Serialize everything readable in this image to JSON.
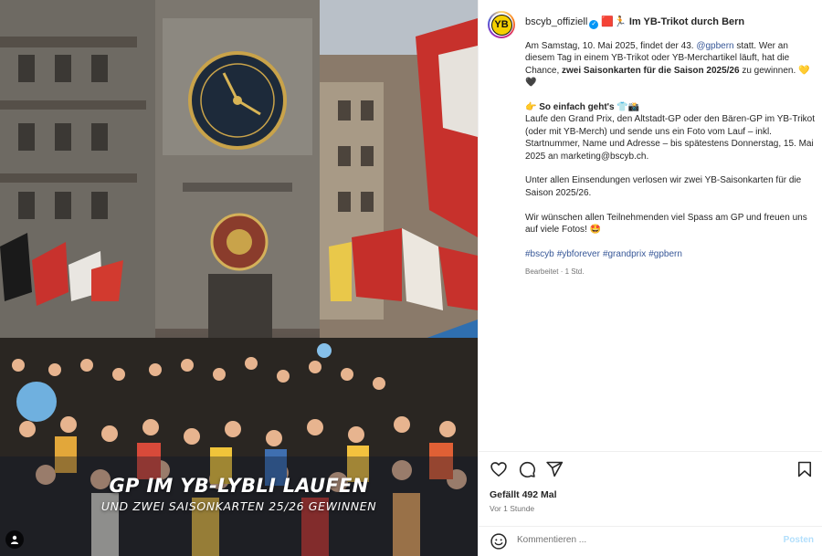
{
  "media": {
    "overlay_title": "GP IM YB-LYBLI LAUFEN",
    "overlay_subtitle": "UND ZWEI SAISONKARTEN 25/26 GEWINNEN"
  },
  "post": {
    "username": "bscyb_offiziell",
    "verified_icon": "verified-badge-icon",
    "headline_emojis": "🟥🏃",
    "headline": "Im YB-Trikot durch Bern",
    "p1_a": "Am Samstag, 10. Mai 2025, findet der 43. ",
    "p1_link": "@gpbern",
    "p1_b": " statt. Wer an diesem Tag in einem YB-Trikot oder YB-Merchartikel läuft, hat die Chance, ",
    "p1_bold": "zwei Saisonkarten für die Saison 2025/26",
    "p1_c": " zu gewinnen. 💛🖤",
    "p2_title": "👉 So einfach geht's 👕📸",
    "p2_text": "Laufe den Grand Prix, den Altstadt-GP oder den Bären-GP im YB-Trikot (oder mit YB-Merch) und sende uns ein Foto vom Lauf – inkl. Startnummer, Name und Adresse – bis spätestens Donnerstag, 15. Mai 2025 an marketing@bscyb.ch.",
    "p3": "Unter allen Einsendungen verlosen wir zwei YB-Saisonkarten für die Saison 2025/26.",
    "p4": "Wir wünschen allen Teilnehmenden viel Spass am GP und freuen uns auf viele Fotos! 🤩",
    "hashtags": [
      "#bscyb",
      "#ybforever",
      "#grandprix",
      "#gpbern"
    ],
    "meta": "Bearbeitet · 1 Std."
  },
  "actions": {
    "likes": "Gefällt 492 Mal",
    "time_ago": "Vor 1 Stunde"
  },
  "comment": {
    "placeholder": "Kommentieren ...",
    "post_label": "Posten"
  },
  "colors": {
    "link": "#385898",
    "yb_yellow": "#f5d000",
    "post_disabled": "#b2dffc"
  }
}
